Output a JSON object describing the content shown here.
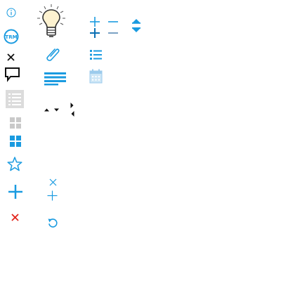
{
  "colors": {
    "blue": "#1a9be0",
    "dark_blue": "#0a6fb3",
    "black": "#111111",
    "gray": "#c9c9c9",
    "light_gray": "#dcdcdc",
    "red": "#e2231a",
    "bulb_fill": "#fdf2d0"
  },
  "icons": [
    "info-icon",
    "trm-badge-icon",
    "close-icon",
    "comment-icon",
    "list-view-icon",
    "grid-view-icon",
    "favorite-star-icon",
    "add-icon",
    "delete-icon",
    "lightbulb-icon",
    "attachment-icon",
    "align-text-icon",
    "sort-arrows-icon",
    "expand-arrows-icon",
    "remove-small-icon",
    "add-small-icon",
    "undo-icon",
    "expand-all-icon",
    "collapse-all-icon",
    "bulleted-list-icon",
    "calendar-icon",
    "spinner-arrows-icon"
  ],
  "badge": {
    "label": "TRM"
  }
}
